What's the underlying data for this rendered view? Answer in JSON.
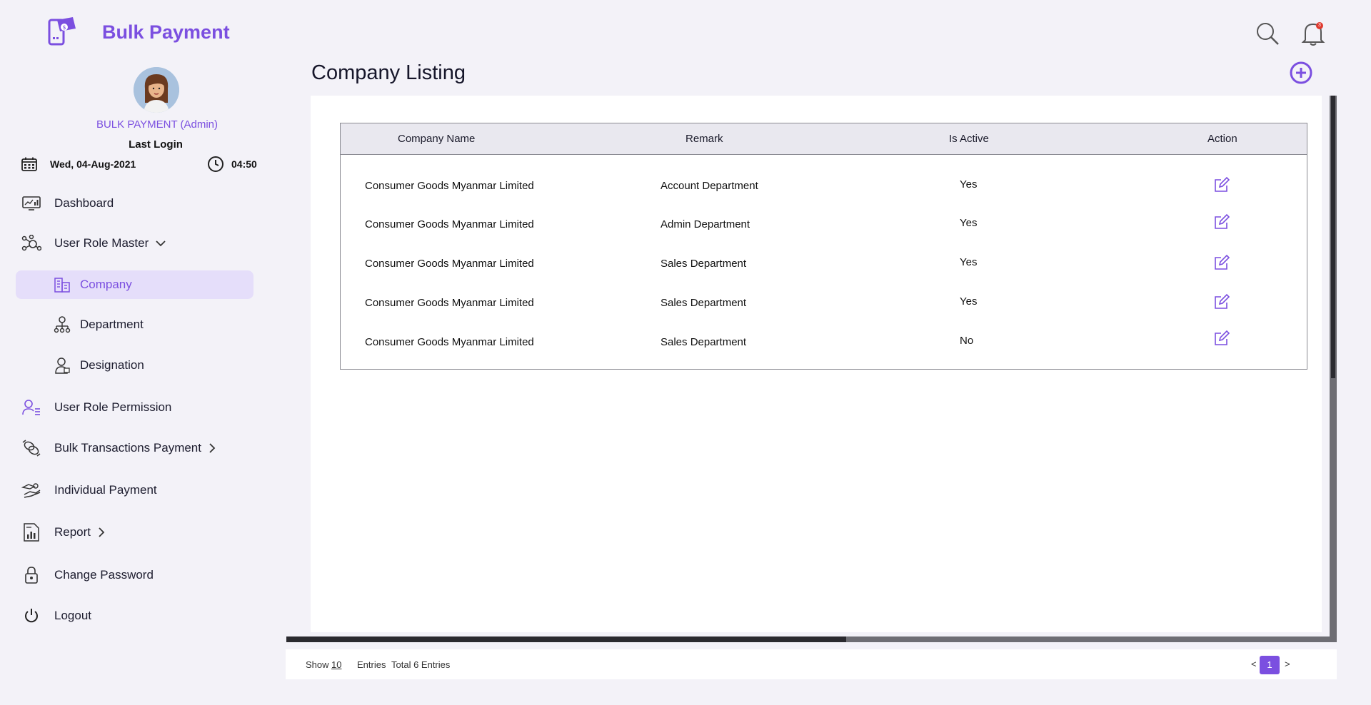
{
  "app": {
    "title": "Bulk Payment",
    "user_role": "BULK PAYMENT (Admin)",
    "last_login_label": "Last Login",
    "last_login_date": "Wed, 04-Aug-2021",
    "last_login_time": "04:50",
    "accent_color": "#7b4fe0",
    "notification_count": "3"
  },
  "sidebar": {
    "items": [
      {
        "label": "Dashboard",
        "icon": "dashboard-icon"
      },
      {
        "label": "User Role Master",
        "icon": "user-role-master-icon",
        "expanded": true
      },
      {
        "label": "Company",
        "icon": "company-building-icon",
        "active": true
      },
      {
        "label": "Department",
        "icon": "department-hierarchy-icon"
      },
      {
        "label": "Designation",
        "icon": "designation-person-icon"
      },
      {
        "label": "User Role Permission",
        "icon": "user-permission-icon"
      },
      {
        "label": "Bulk Transactions Payment",
        "icon": "bulk-transactions-icon"
      },
      {
        "label": "Individual Payment",
        "icon": "individual-payment-icon"
      },
      {
        "label": "Report",
        "icon": "report-icon"
      },
      {
        "label": "Change Password",
        "icon": "change-password-icon"
      },
      {
        "label": "Logout",
        "icon": "power-icon"
      }
    ]
  },
  "main": {
    "page_title": "Company Listing",
    "table": {
      "columns": [
        "Company Name",
        "Remark",
        "Is Active",
        "Action"
      ],
      "rows": [
        {
          "company": "Consumer Goods Myanmar Limited",
          "remark": "Account Department",
          "active": "Yes"
        },
        {
          "company": "Consumer Goods Myanmar Limited",
          "remark": "Admin Department",
          "active": "Yes"
        },
        {
          "company": "Consumer Goods Myanmar Limited",
          "remark": "Sales Department",
          "active": "Yes"
        },
        {
          "company": "Consumer Goods Myanmar Limited",
          "remark": "Sales Department",
          "active": "Yes"
        },
        {
          "company": "Consumer Goods Myanmar Limited",
          "remark": "Sales Department",
          "active": "No"
        }
      ]
    }
  },
  "footer": {
    "show_label": "Show",
    "show_value": "10",
    "entries_label": "Entries",
    "total_label": "Total 6 Entries",
    "prev": "<",
    "current_page": "1",
    "next": ">"
  }
}
